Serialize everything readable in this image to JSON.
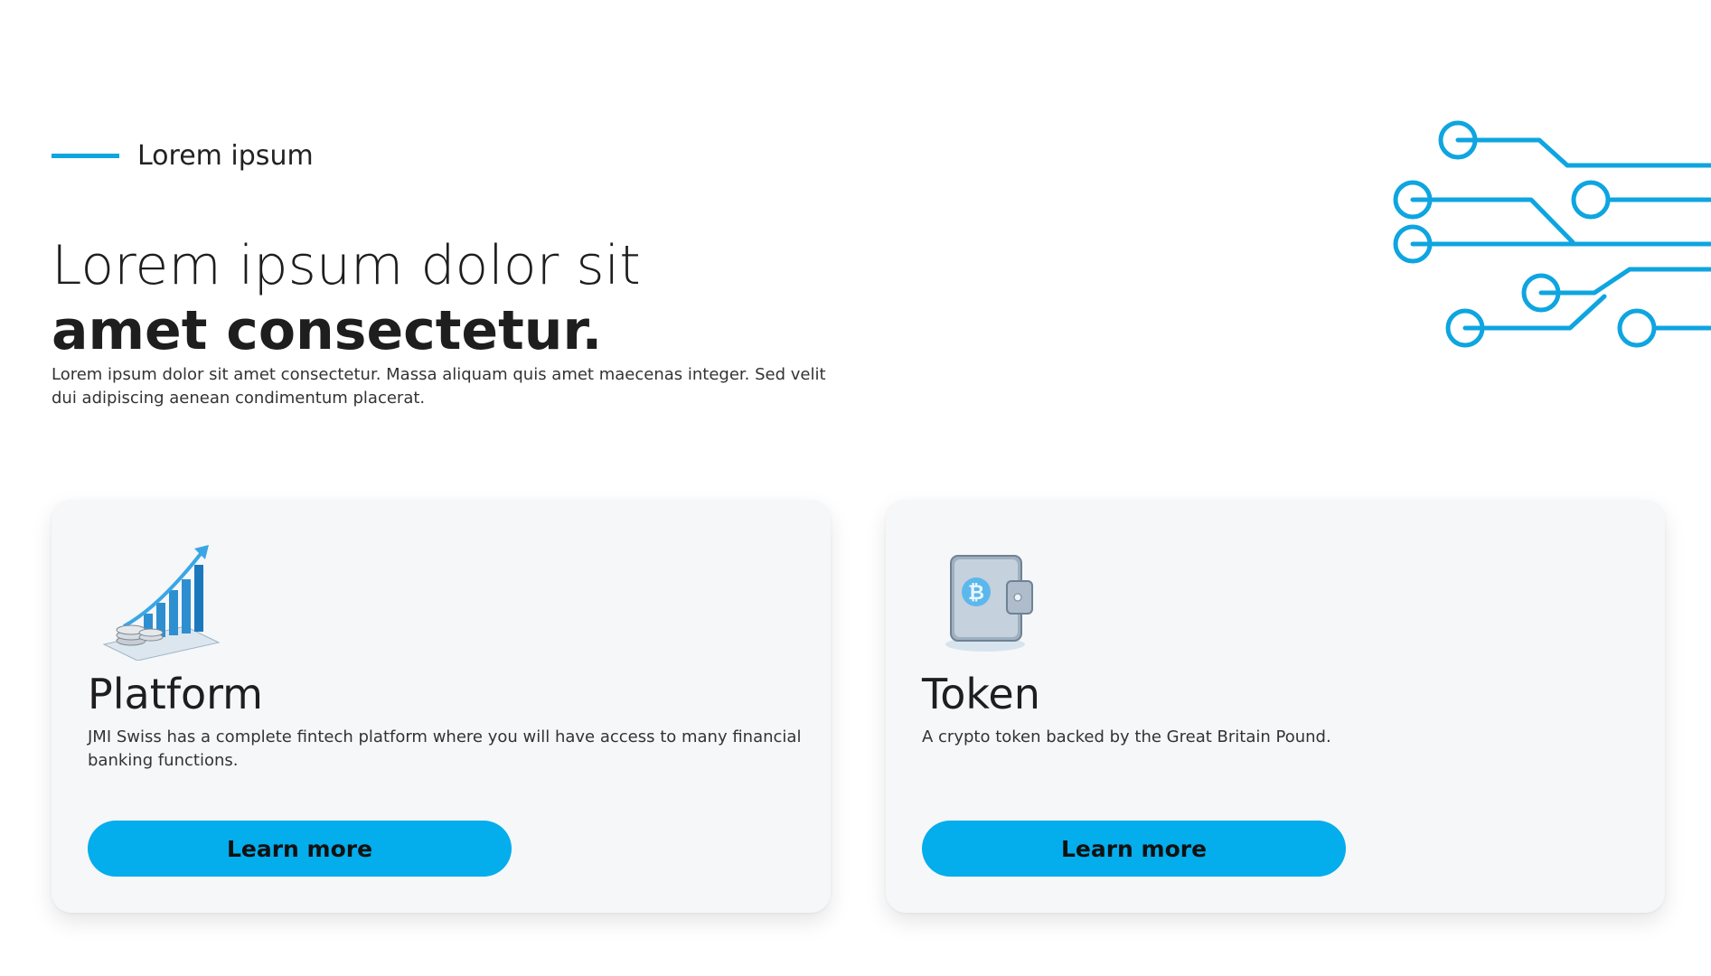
{
  "section": {
    "eyebrow": "Lorem ipsum",
    "headline_light": "Lorem ipsum dolor sit",
    "headline_bold": "amet consectetur.",
    "intro": "Lorem ipsum dolor sit amet consectetur. Massa aliquam quis amet maecenas integer. Sed velit dui adipiscing aenean condimentum placerat."
  },
  "cards": [
    {
      "title": "Platform",
      "description": "JMI Swiss has a complete fintech platform where you will have access to many financial banking functions.",
      "button_label": "Learn more",
      "icon": "growth-chart-coins-icon"
    },
    {
      "title": "Token",
      "description": "A crypto token backed by the Great Britain Pound.",
      "button_label": "Learn more",
      "icon": "bitcoin-wallet-icon"
    }
  ],
  "colors": {
    "accent": "#0ea5e0",
    "button": "#04adec",
    "card_bg": "#f6f7f9"
  }
}
